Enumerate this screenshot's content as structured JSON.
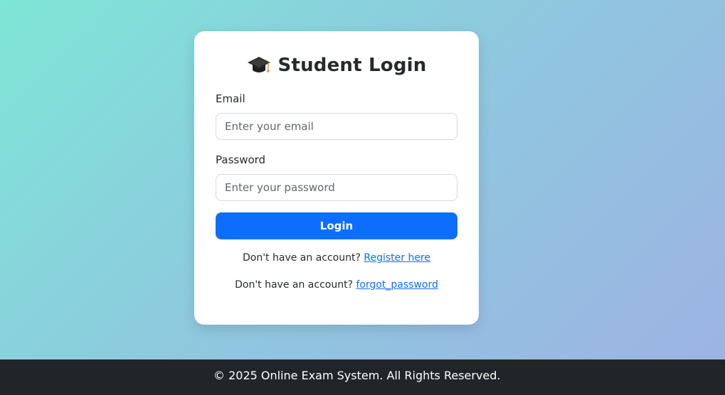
{
  "login": {
    "title": "Student Login",
    "icon": "graduation-cap-icon",
    "email_label": "Email",
    "email_placeholder": "Enter your email",
    "email_value": "",
    "password_label": "Password",
    "password_placeholder": "Enter your password",
    "password_value": "",
    "login_button": "Login",
    "register_prompt": "Don't have an account?",
    "register_link": "Register here",
    "forgot_prompt": "Don't have an account?",
    "forgot_link": "forgot_password"
  },
  "footer": {
    "text": "© 2025 Online Exam System. All Rights Reserved."
  },
  "colors": {
    "primary": "#0d6efd",
    "footer_bg": "#212529",
    "gradient_start": "#7ee6d6",
    "gradient_end": "#9eb2e3"
  }
}
